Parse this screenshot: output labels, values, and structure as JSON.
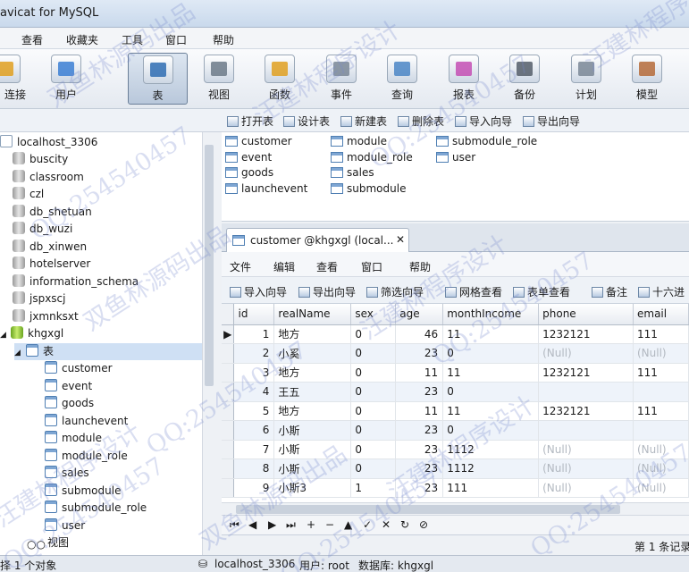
{
  "window": {
    "title": "avicat for MySQL"
  },
  "menu": [
    "查看",
    "收藏夹",
    "工具",
    "窗口",
    "帮助"
  ],
  "toolbar": {
    "buttons": [
      {
        "label": "连接",
        "icon": "connect-icon",
        "color": "#e0a020"
      },
      {
        "label": "用户",
        "icon": "user-icon",
        "color": "#3b7fd4"
      },
      {
        "label": "表",
        "icon": "table-icon",
        "color": "#2f6db3"
      },
      {
        "label": "视图",
        "icon": "view-icon",
        "color": "#6c7a88"
      },
      {
        "label": "函数",
        "icon": "function-icon",
        "color": "#e0a020"
      },
      {
        "label": "事件",
        "icon": "event-icon",
        "color": "#7a8796"
      },
      {
        "label": "查询",
        "icon": "query-icon",
        "color": "#4b86c6"
      },
      {
        "label": "报表",
        "icon": "report-icon",
        "color": "#c44fb4"
      },
      {
        "label": "备份",
        "icon": "backup-icon",
        "color": "#555e6a"
      },
      {
        "label": "计划",
        "icon": "schedule-icon",
        "color": "#7a8796"
      },
      {
        "label": "模型",
        "icon": "model-icon",
        "color": "#b56b3a"
      }
    ]
  },
  "object_toolbar": [
    "打开表",
    "设计表",
    "新建表",
    "删除表",
    "导入向导",
    "导出向导"
  ],
  "tree": {
    "connection": "localhost_3306",
    "databases": [
      "buscity",
      "classroom",
      "czl",
      "db_shetuan",
      "db_wuzi",
      "db_xinwen",
      "hotelserver",
      "information_schema",
      "jspxscj",
      "jxmnksxt",
      "khgxgl"
    ],
    "tables_folder": "表",
    "tables": [
      "customer",
      "event",
      "goods",
      "launchevent",
      "module",
      "module_role",
      "sales",
      "submodule",
      "submodule_role",
      "user"
    ],
    "views_folder": "视图"
  },
  "object_list": {
    "col1": [
      "customer",
      "event",
      "goods",
      "launchevent"
    ],
    "col2": [
      "module",
      "module_role",
      "sales",
      "submodule"
    ],
    "col3": [
      "submodule_role",
      "user"
    ]
  },
  "tab": {
    "title": "customer @khgxgl (local..."
  },
  "sub_menu": [
    "文件",
    "编辑",
    "查看",
    "窗口",
    "帮助"
  ],
  "sub_toolbar": [
    "导入向导",
    "导出向导",
    "筛选向导",
    "网格查看",
    "表单查看",
    "备注",
    "十六进"
  ],
  "grid": {
    "columns": [
      "id",
      "realName",
      "sex",
      "age",
      "monthIncome",
      "phone",
      "email"
    ],
    "rows": [
      [
        "1",
        "地方",
        "0",
        "46",
        "11",
        "1232121",
        "111"
      ],
      [
        "2",
        "小奚",
        "0",
        "23",
        "0",
        "(Null)",
        "(Null)"
      ],
      [
        "3",
        "地方",
        "0",
        "11",
        "11",
        "1232121",
        "111"
      ],
      [
        "4",
        "王五",
        "0",
        "23",
        "0",
        "",
        ""
      ],
      [
        "5",
        "地方",
        "0",
        "11",
        "11",
        "1232121",
        "111"
      ],
      [
        "6",
        "小斯",
        "0",
        "23",
        "0",
        "",
        ""
      ],
      [
        "7",
        "小斯",
        "0",
        "23",
        "1112",
        "(Null)",
        "(Null)"
      ],
      [
        "8",
        "小斯",
        "0",
        "23",
        "1112",
        "(Null)",
        "(Null)"
      ],
      [
        "9",
        "小斯3",
        "1",
        "23",
        "111",
        "(Null)",
        "(Null)"
      ]
    ]
  },
  "navbar": [
    "⏮",
    "◀",
    "▶",
    "⏭",
    "+",
    "−",
    "▲",
    "✓",
    "✕",
    "↻",
    "⊘"
  ],
  "page_status": "第 1 条记录",
  "status": {
    "left": "择 1 个对象",
    "connection": "localhost_3306",
    "user": "用户: root",
    "database": "数据库: khgxgl"
  },
  "watermark": {
    "texts": [
      "双鱼林源码出品",
      "QQ:254540457",
      "汪建林程序设计"
    ],
    "color": "#7887cd"
  }
}
